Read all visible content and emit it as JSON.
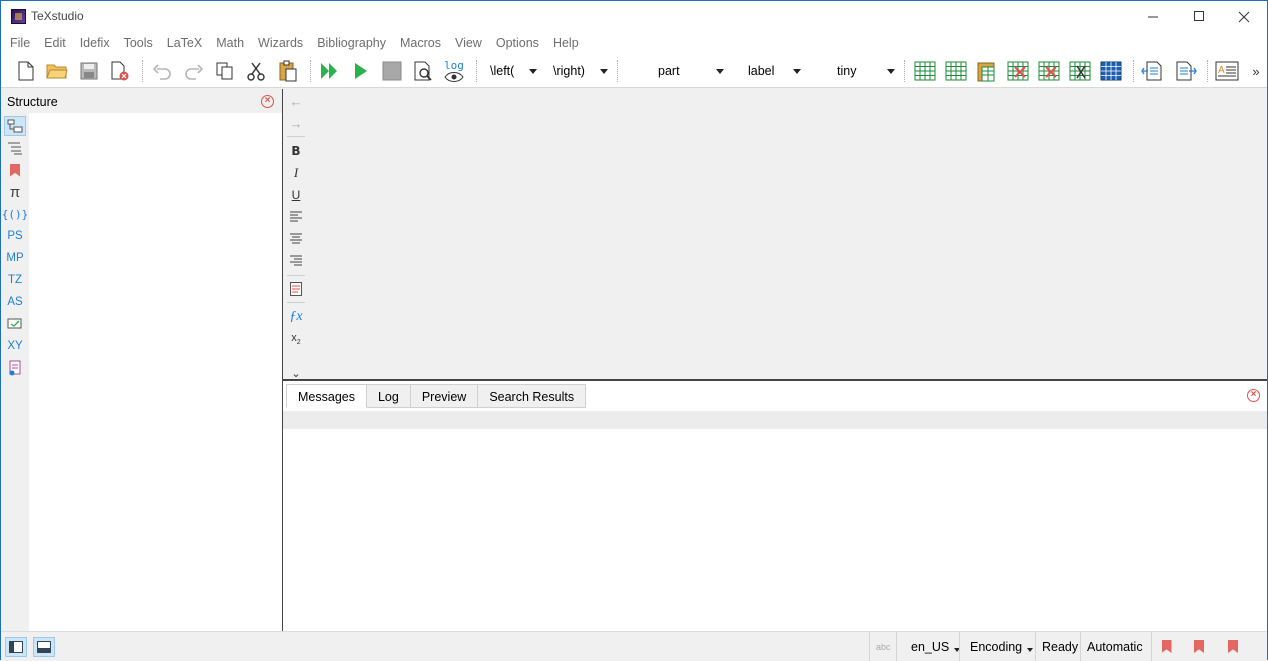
{
  "window": {
    "title": "TeXstudio"
  },
  "menubar": {
    "items": [
      "File",
      "Edit",
      "Idefix",
      "Tools",
      "LaTeX",
      "Math",
      "Wizards",
      "Bibliography",
      "Macros",
      "View",
      "Options",
      "Help"
    ]
  },
  "toolbar": {
    "log_label": "log",
    "left_delim": "\\left(",
    "right_delim": "\\right)",
    "section": "part",
    "ref": "label",
    "size": "tiny",
    "overflow": "»"
  },
  "structure": {
    "title": "Structure",
    "side_items": {
      "ps": "PS",
      "mp": "MP",
      "tz": "TZ",
      "as": "AS",
      "xy": "XY"
    }
  },
  "format_bar": {
    "back": "←",
    "forward": "→",
    "bold": "B",
    "italic": "I",
    "underline": "U",
    "more": "⌄"
  },
  "messages": {
    "tabs": [
      "Messages",
      "Log",
      "Preview",
      "Search Results"
    ],
    "active_tab": "Messages"
  },
  "statusbar": {
    "language": "en_US",
    "encoding": "Encoding",
    "status": "Ready",
    "mode": "Automatic"
  },
  "colors": {
    "accent": "#1e7fd1",
    "close": "#e0504a",
    "play": "#2bb24c"
  }
}
